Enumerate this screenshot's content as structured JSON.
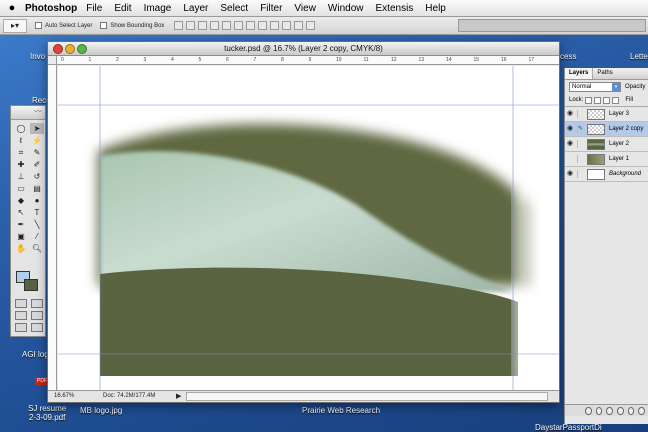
{
  "menubar": {
    "app_name": "Photoshop",
    "items": [
      "File",
      "Edit",
      "Image",
      "Layer",
      "Select",
      "Filter",
      "View",
      "Window",
      "Extensis",
      "Help"
    ]
  },
  "options_bar": {
    "auto_select_label": "Auto Select Layer",
    "bounding_box_label": "Show Bounding Box"
  },
  "desktop": {
    "icons": [
      "Invo",
      "Rece",
      "AGI logo",
      "SJ resume\n2-3-09.pdf",
      "MB logo.jpg",
      "Prairie Web Research",
      "DaystarPassportDi",
      "cess",
      "Lette"
    ]
  },
  "document": {
    "title": "tucker.psd @ 16.7% (Layer 2 copy, CMYK/8)",
    "zoom": "16.67%",
    "doc_size": "Doc: 74.2M/177.4M",
    "ruler_ticks": [
      "0",
      "1",
      "2",
      "3",
      "4",
      "5",
      "6",
      "7",
      "8",
      "9",
      "10",
      "11",
      "12",
      "13",
      "14",
      "15",
      "16",
      "17"
    ]
  },
  "layers_panel": {
    "tabs": [
      "Layers",
      "Paths"
    ],
    "blend_mode": "Normal",
    "opacity_label": "Opacity",
    "lock_label": "Lock:",
    "fill_label": "Fill",
    "layers": [
      {
        "name": "Layer 3",
        "visible": true,
        "selected": false
      },
      {
        "name": "Layer 2 copy",
        "visible": true,
        "selected": true
      },
      {
        "name": "Layer 2",
        "visible": true,
        "selected": false
      },
      {
        "name": "Layer 1",
        "visible": false,
        "selected": false
      },
      {
        "name": "Background",
        "visible": true,
        "selected": false
      }
    ]
  },
  "colors": {
    "foreground": "#aecfea",
    "background": "#5a6140",
    "accent": "#2d5fa3"
  }
}
